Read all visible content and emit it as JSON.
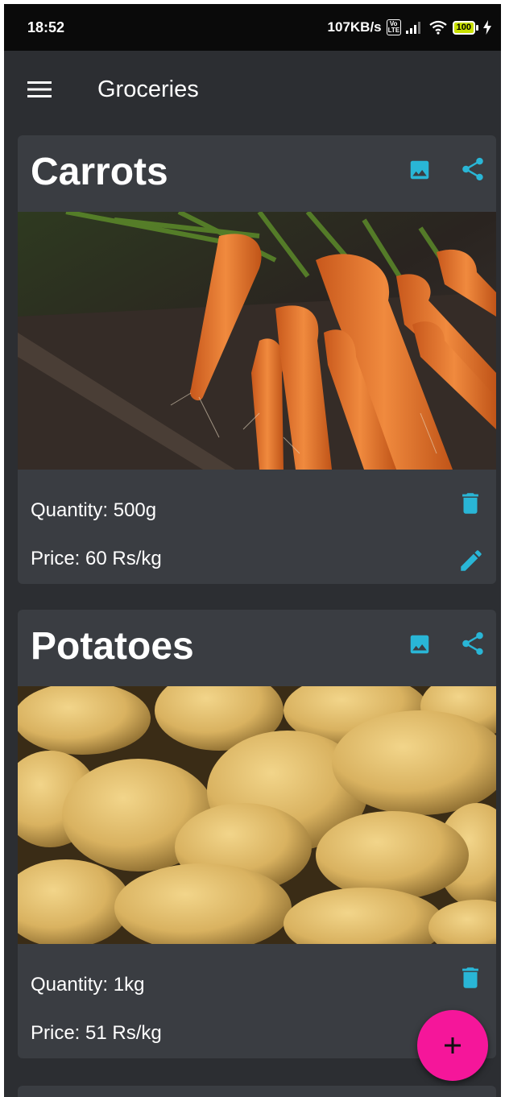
{
  "status_bar": {
    "time": "18:52",
    "speed": "107KB/s",
    "volte_label": "Vo LTE",
    "battery": "100"
  },
  "app_bar": {
    "title": "Groceries"
  },
  "colors": {
    "accent": "#29b6d6",
    "fab": "#f5169a",
    "card": "#3a3d42",
    "background": "#2c2e32"
  },
  "items": [
    {
      "name": "Carrots",
      "quantity": "Quantity: 500g",
      "price": "Price: 60 Rs/kg",
      "image_icon": "image-icon",
      "share_icon": "share-icon",
      "delete_icon": "delete-icon",
      "edit_icon": "edit-icon"
    },
    {
      "name": "Potatoes",
      "quantity": "Quantity: 1kg",
      "price": "Price: 51 Rs/kg",
      "image_icon": "image-icon",
      "share_icon": "share-icon",
      "delete_icon": "delete-icon"
    }
  ],
  "fab": {
    "icon": "add-icon",
    "label": "+"
  }
}
